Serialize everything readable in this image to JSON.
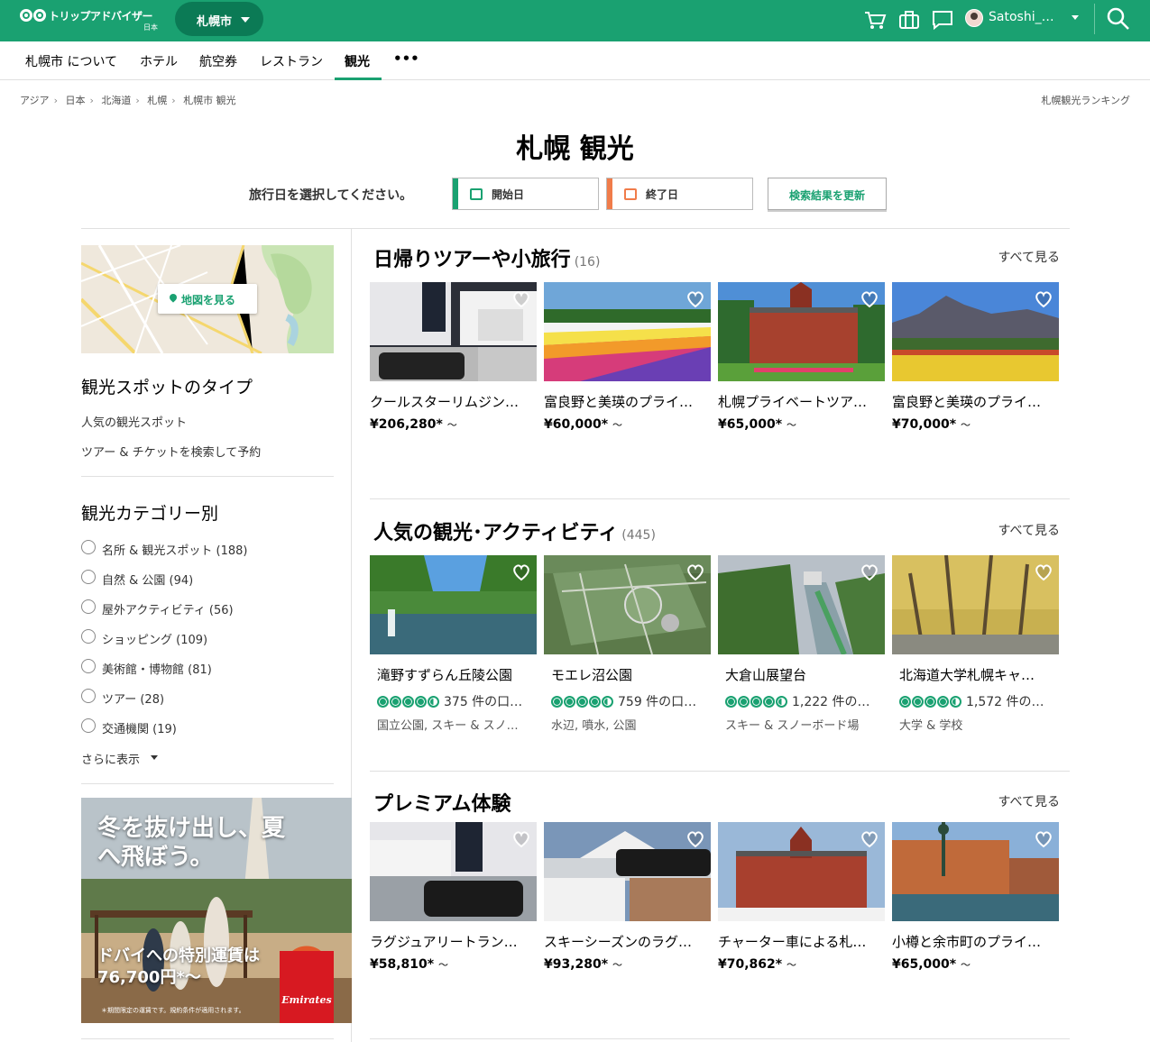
{
  "header": {
    "logo_text": "トリップアドバイザー",
    "logo_sub": "日本",
    "city": "札幌市",
    "user": "Satoshi_…"
  },
  "subnav": [
    "札幌市 について",
    "ホテル",
    "航空券",
    "レストラン",
    "観光",
    "•••"
  ],
  "breadcrumb": [
    "アジア",
    "日本",
    "北海道",
    "札幌",
    "札幌市 観光"
  ],
  "ranking_link": "札幌観光ランキング",
  "title": "札幌 観光",
  "dates": {
    "prompt": "旅行日を選択してください。",
    "start": "開始日",
    "end": "終了日",
    "update": "検索結果を更新"
  },
  "sidebar": {
    "map_button": "地図を見る",
    "type_heading": "観光スポットのタイプ",
    "type_links": [
      "人気の観光スポット",
      "ツアー & チケットを検索して予約"
    ],
    "category_heading": "観光カテゴリー別",
    "categories": [
      "名所 & 観光スポット (188)",
      "自然 & 公園 (94)",
      "屋外アクティビティ (56)",
      "ショッピング (109)",
      "美術館・博物館 (81)",
      "ツアー (28)",
      "交通機関 (19)"
    ],
    "more": "さらに表示",
    "ad": {
      "headline": "冬を抜け出し、夏へ飛ぼう。",
      "offer_line1": "ドバイへの特別運賃は",
      "offer_line2": "76,700円*～",
      "fine": "＊期間限定の運賃です。規約条件が適用されます。",
      "brand": "Emirates"
    }
  },
  "sections": {
    "tours": {
      "title": "日帰りツアーや小旅行",
      "count": "(16)",
      "see_all": "すべて見る",
      "items": [
        {
          "name": "クールスターリムジン…",
          "price": "¥206,280*",
          "unit": "～"
        },
        {
          "name": "富良野と美瑛のプライ…",
          "price": "¥60,000*",
          "unit": "～"
        },
        {
          "name": "札幌プライベートツア…",
          "price": "¥65,000*",
          "unit": "～"
        },
        {
          "name": "富良野と美瑛のプライ…",
          "price": "¥70,000*",
          "unit": "～"
        }
      ]
    },
    "popular": {
      "title": "人気の観光･アクティビティ",
      "count": "(445)",
      "see_all": "すべて見る",
      "items": [
        {
          "name": "滝野すずらん丘陵公園",
          "reviews": "375 件の口…",
          "rating": 4.5,
          "category": "国立公園, スキー & スノ…"
        },
        {
          "name": "モエレ沼公園",
          "reviews": "759 件の口…",
          "rating": 4.5,
          "category": "水辺, 噴水, 公園"
        },
        {
          "name": "大倉山展望台",
          "reviews": "1,222 件の…",
          "rating": 4.5,
          "category": "スキー & スノーボード場"
        },
        {
          "name": "北海道大学札幌キャ…",
          "reviews": "1,572 件の…",
          "rating": 4.5,
          "category": "大学 & 学校"
        }
      ]
    },
    "premium": {
      "title": "プレミアム体験",
      "see_all": "すべて見る",
      "items": [
        {
          "name": "ラグジュアリートラン…",
          "price": "¥58,810*",
          "unit": "～"
        },
        {
          "name": "スキーシーズンのラグ…",
          "price": "¥93,280*",
          "unit": "～"
        },
        {
          "name": "チャーター車による札…",
          "price": "¥70,862*",
          "unit": "～"
        },
        {
          "name": "小樽と余市町のプライ…",
          "price": "¥65,000*",
          "unit": "～"
        }
      ]
    }
  },
  "colors": {
    "brand": "#1aa171",
    "brand_dark": "#0b7a55",
    "start_bar": "#1aa171",
    "end_bar": "#f07c4a"
  }
}
